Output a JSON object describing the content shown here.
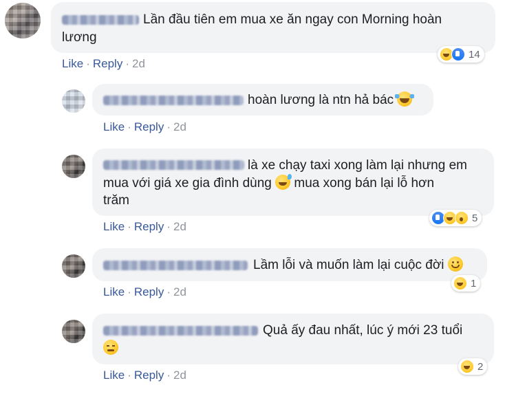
{
  "comments": [
    {
      "text_lines": [
        "Lần đầu tiên em mua xe ăn ngay con Morning hoàn",
        "lương"
      ],
      "actions": {
        "like": "Like",
        "reply": "Reply",
        "time": "2d"
      },
      "reactions": {
        "icons": [
          "haha-icon",
          "like-icon"
        ],
        "count": "14"
      }
    },
    {
      "text_lines": [
        "hoàn lương là ntn hả bác"
      ],
      "emoji_after": "tears-of-joy-emoji",
      "actions": {
        "like": "Like",
        "reply": "Reply",
        "time": "2d"
      }
    },
    {
      "text_lines": [
        "là xe chạy taxi xong làm lại nhưng em",
        "mua với giá xe gia đình dùng",
        "mua xong bán lại lỗ hơn",
        "trăm"
      ],
      "emoji_inline": "sweat-smile-emoji",
      "actions": {
        "like": "Like",
        "reply": "Reply",
        "time": "2d"
      },
      "reactions": {
        "icons": [
          "like-icon",
          "haha-icon",
          "wow-icon"
        ],
        "count": "5"
      }
    },
    {
      "text_lines": [
        "Lầm lỗi và muốn làm lại cuộc đời"
      ],
      "emoji_after": "smile-emoji",
      "actions": {
        "like": "Like",
        "reply": "Reply",
        "time": "2d"
      },
      "reactions": {
        "icons": [
          "haha-icon"
        ],
        "count": "1"
      }
    },
    {
      "text_lines": [
        "Quả ấy đau nhất, lúc ý mới 23 tuổi"
      ],
      "emoji_line2": "pensive-emoji",
      "actions": {
        "like": "Like",
        "reply": "Reply",
        "time": "2d"
      },
      "reactions": {
        "icons": [
          "haha-icon"
        ],
        "count": "2"
      }
    }
  ],
  "colors": {
    "bubble": "#f2f3f5",
    "link": "#385898",
    "meta": "#90949c",
    "like_blue": "#1877f2",
    "emoji_yellow": "#ffcc33"
  }
}
